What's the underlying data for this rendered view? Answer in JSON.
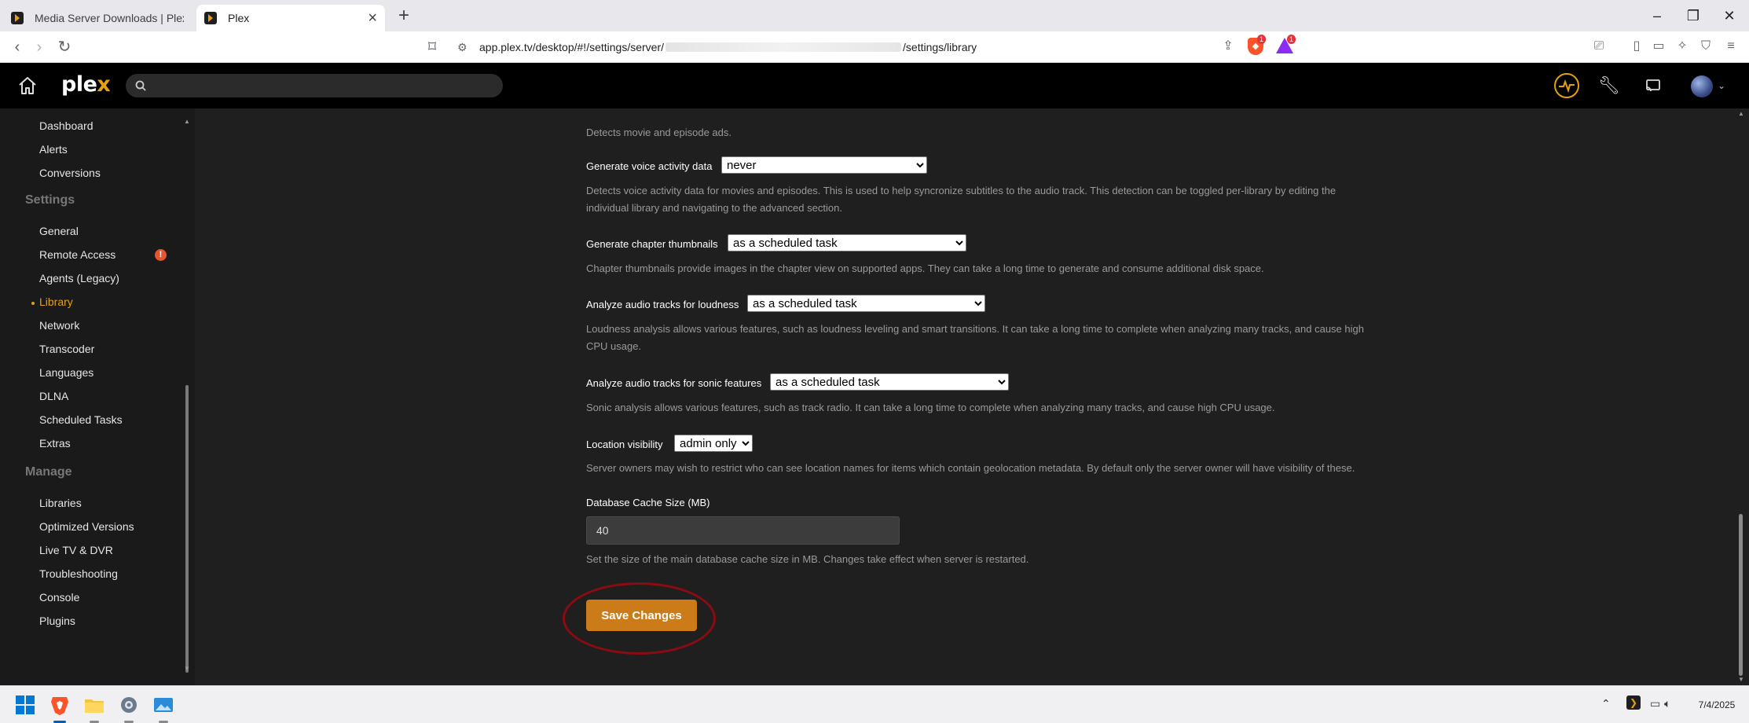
{
  "browser": {
    "tabs": [
      {
        "title": "Media Server Downloads | Plex Media Server"
      },
      {
        "title": "Plex"
      }
    ],
    "url_prefix": "app.plex.tv/desktop/#!/settings/server/",
    "url_suffix": "/settings/library",
    "shields_count": "1",
    "rewards_count": "1"
  },
  "plex": {
    "logo_main": "ple",
    "logo_x": "x",
    "search_placeholder": ""
  },
  "sidebar": {
    "top_items": [
      "Dashboard",
      "Alerts",
      "Conversions"
    ],
    "settings_header": "Settings",
    "settings_items": [
      "General",
      "Remote Access",
      "Agents (Legacy)",
      "Library",
      "Network",
      "Transcoder",
      "Languages",
      "DLNA",
      "Scheduled Tasks",
      "Extras"
    ],
    "active_item": "Library",
    "remote_access_warning": "!",
    "manage_header": "Manage",
    "manage_items": [
      "Libraries",
      "Optimized Versions",
      "Live TV & DVR",
      "Troubleshooting",
      "Console",
      "Plugins"
    ]
  },
  "settings": {
    "ads_desc": "Detects movie and episode ads.",
    "voice": {
      "label": "Generate voice activity data",
      "value": "never",
      "desc1": "Detects voice activity data for movies and episodes. This is used to help syncronize subtitles to the audio track. This detection can be toggled per-library by editing the",
      "desc2": "individual library and navigating to the advanced section."
    },
    "chapter": {
      "label": "Generate chapter thumbnails",
      "value": "as a scheduled task",
      "desc": "Chapter thumbnails provide images in the chapter view on supported apps. They can take a long time to generate and consume additional disk space."
    },
    "loudness": {
      "label": "Analyze audio tracks for loudness",
      "value": "as a scheduled task",
      "desc1": "Loudness analysis allows various features, such as loudness leveling and smart transitions. It can take a long time to complete when analyzing many tracks, and cause high",
      "desc2": "CPU usage."
    },
    "sonic": {
      "label": "Analyze audio tracks for sonic features",
      "value": "as a scheduled task",
      "desc": "Sonic analysis allows various features, such as track radio. It can take a long time to complete when analyzing many tracks, and cause high CPU usage."
    },
    "location": {
      "label": "Location visibility",
      "value": "admin only",
      "desc": "Server owners may wish to restrict who can see location names for items which contain geolocation metadata. By default only the server owner will have visibility of these."
    },
    "db_cache": {
      "label": "Database Cache Size (MB)",
      "value": "40",
      "desc": "Set the size of the main database cache size in MB. Changes take effect when server is restarted."
    },
    "save_label": "Save Changes"
  },
  "taskbar": {
    "date": "7/4/2025"
  }
}
